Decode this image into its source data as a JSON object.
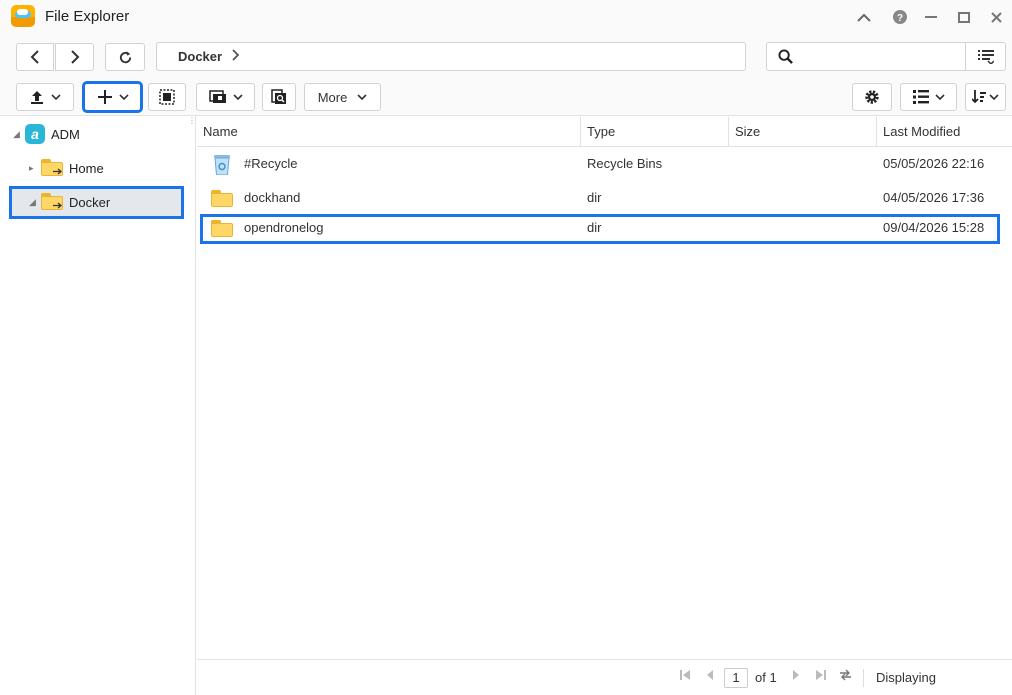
{
  "window": {
    "title": "File Explorer"
  },
  "toolbar": {
    "breadcrumb": "Docker",
    "search_placeholder": "",
    "more_label": "More"
  },
  "tree": {
    "root": "ADM",
    "items": [
      {
        "label": "Home"
      },
      {
        "label": "Docker"
      }
    ]
  },
  "columns": [
    "Name",
    "Type",
    "Size",
    "Last Modified"
  ],
  "files": [
    {
      "name": "#Recycle",
      "type": "Recycle Bins",
      "size": "",
      "modified": "05/05/2026 22:16",
      "icon": "recycle-bin-icon"
    },
    {
      "name": "dockhand",
      "type": "dir",
      "size": "",
      "modified": "04/05/2026 17:36",
      "icon": "folder-icon"
    },
    {
      "name": "opendronelog",
      "type": "dir",
      "size": "",
      "modified": "09/04/2026 15:28",
      "icon": "folder-icon"
    }
  ],
  "pagination": {
    "page": "1",
    "of_label": "of 1",
    "status": "Displaying"
  },
  "colors": {
    "accent": "#1a73e8",
    "folder": "#ffd766",
    "app_icon": "#ffb300"
  }
}
